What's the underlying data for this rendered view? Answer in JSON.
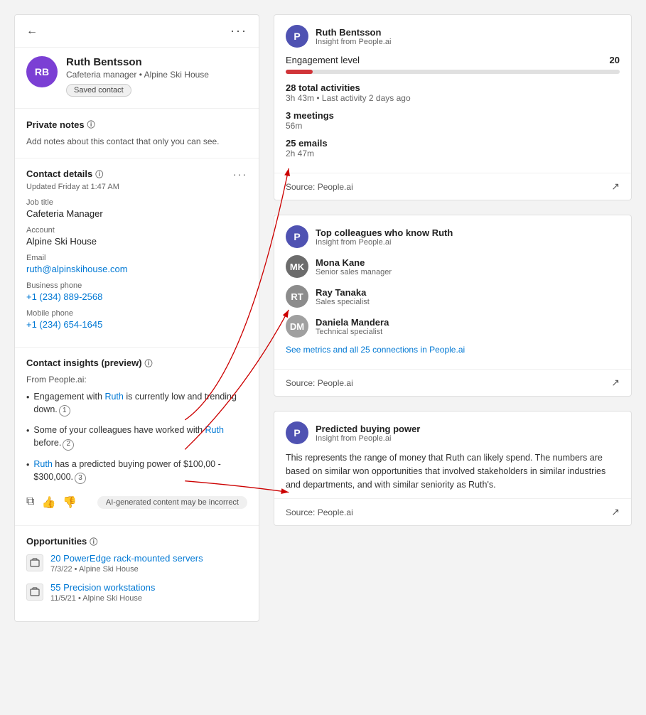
{
  "header": {
    "back_label": "←",
    "more_label": "···"
  },
  "contact": {
    "initials": "RB",
    "name": "Ruth Bentsson",
    "subtitle": "Cafeteria manager • Alpine Ski House",
    "saved_label": "Saved contact"
  },
  "private_notes": {
    "title": "Private notes",
    "text": "Add notes about this contact that only you can see."
  },
  "contact_details": {
    "title": "Contact details",
    "updated": "Updated Friday at 1:47 AM",
    "job_title_label": "Job title",
    "job_title": "Cafeteria Manager",
    "account_label": "Account",
    "account": "Alpine Ski House",
    "email_label": "Email",
    "email": "ruth@alpinskihouse.com",
    "business_phone_label": "Business phone",
    "business_phone": "+1 (234) 889-2568",
    "mobile_phone_label": "Mobile phone",
    "mobile_phone": "+1 (234) 654-1645"
  },
  "insights": {
    "title": "Contact insights (preview)",
    "from_label": "From People.ai:",
    "item1": "Engagement with Ruth is currently low and trending down.",
    "item2": "Some of your colleagues have worked with Ruth before.",
    "item3": "Ruth has a predicted buying power of $100,00 - $300,000.",
    "item1_link": "Ruth",
    "item2_link": "Ruth",
    "item3_link": "Ruth",
    "badge1": "1",
    "badge2": "2",
    "badge3": "3",
    "ai_disclaimer": "AI-generated content may be incorrect"
  },
  "opportunities": {
    "title": "Opportunities",
    "items": [
      {
        "title": "20 PowerEdge rack-mounted servers",
        "meta": "7/3/22 • Alpine Ski House"
      },
      {
        "title": "55 Precision workstations",
        "meta": "11/5/21 • Alpine Ski House"
      }
    ]
  },
  "card_engagement": {
    "person_name": "Ruth Bentsson",
    "source": "Insight from People.ai",
    "engagement_label": "Engagement level",
    "engagement_value": "20",
    "progress_pct": 8,
    "activities_title": "28 total activities",
    "activities_sub": "3h 43m • Last activity 2 days ago",
    "meetings_title": "3 meetings",
    "meetings_sub": "56m",
    "emails_title": "25 emails",
    "emails_sub": "2h 47m",
    "source_label": "Source: People.ai"
  },
  "card_colleagues": {
    "title": "Top colleagues who know Ruth",
    "source": "Insight from People.ai",
    "colleagues": [
      {
        "name": "Mona Kane",
        "role": "Senior sales manager",
        "color": "#5a5a5a"
      },
      {
        "name": "Ray Tanaka",
        "role": "Sales specialist",
        "color": "#7a7a7a"
      },
      {
        "name": "Daniela Mandera",
        "role": "Technical specialist",
        "color": "#9a9a9a"
      }
    ],
    "see_metrics": "See metrics and all 25 connections in People.ai",
    "source_label": "Source: People.ai"
  },
  "card_buying_power": {
    "title": "Predicted buying power",
    "source": "Insight from People.ai",
    "text": "This represents the range of money that Ruth can likely spend. The numbers are based on similar won opportunities that involved stakeholders in similar industries and departments, and with similar seniority as Ruth's.",
    "source_label": "Source: People.ai"
  }
}
